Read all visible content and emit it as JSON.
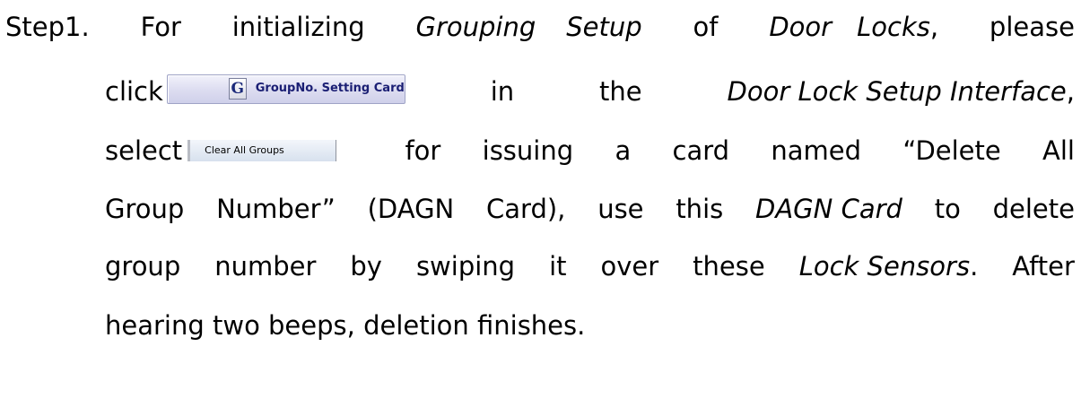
{
  "step_label": "Step1.",
  "lines": {
    "l1": {
      "w1": "For",
      "w2": "initializing",
      "w3": "Grouping",
      "w4": "Setup",
      "w5": "of",
      "w6": "Door",
      "w7": "Locks",
      "w7_punct": ",",
      "w8": "please"
    },
    "l2": {
      "w1": "click",
      "button_icon_letter": "G",
      "button_label": "GroupNo. Setting Card",
      "w2": "in",
      "w3": "the",
      "w4": "Door Lock Setup Interface",
      "w4_punct": ","
    },
    "l3": {
      "w1": "select",
      "list_item_label": "Clear All Groups",
      "w2": "for",
      "w3": "issuing",
      "w4": "a",
      "w5": "card",
      "w6": "named",
      "w7": "“Delete",
      "w8": "All"
    },
    "l4": {
      "w1": "Group",
      "w2": "Number”",
      "w3": "(DAGN",
      "w4": "Card),",
      "w5": "use",
      "w6": "this",
      "w7": "DAGN Card",
      "w8": "to",
      "w9": "delete"
    },
    "l5": {
      "w1": "group",
      "w2": "number",
      "w3": "by",
      "w4": "swiping",
      "w5": "it",
      "w6": "over",
      "w7": "these",
      "w8": "Lock Sensors",
      "w8_punct": ".",
      "w9": "After"
    },
    "l6": "hearing two beeps, deletion finishes.",
    "l7": ""
  },
  "colors": {
    "text": "#000000",
    "button_text": "#1b1f74",
    "button_bg": "#dcdcf0",
    "list_item_bg": "#e4ebf4"
  },
  "icons": {
    "group_button_icon": "g-letter-icon"
  }
}
